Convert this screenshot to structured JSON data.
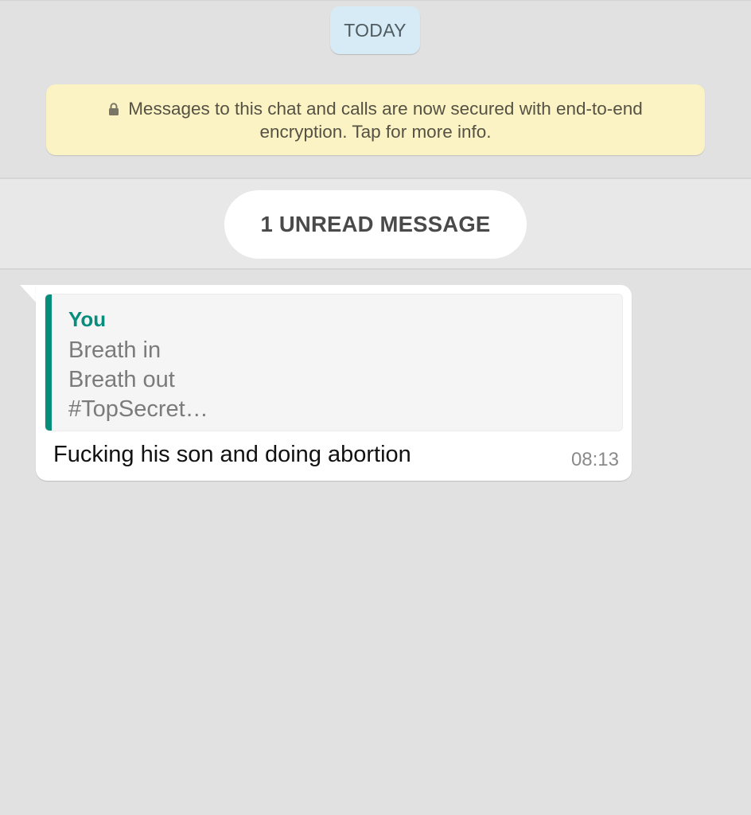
{
  "date_chip": {
    "label": "TODAY"
  },
  "encryption_notice": {
    "line1": "Messages to this chat and calls are now secured with end-to-end",
    "line2": "encryption. Tap for more info.",
    "icon": "lock-icon"
  },
  "unread_divider": {
    "label": "1 UNREAD MESSAGE"
  },
  "message": {
    "quoted": {
      "author": "You",
      "lines": [
        "Breath in",
        "Breath out",
        "#TopSecret…"
      ]
    },
    "text": "Fucking his son and doing abortion",
    "time": "08:13"
  },
  "colors": {
    "chat_background": "#e1e1e1",
    "date_chip_background": "#d6ebf5",
    "encryption_banner_background": "#fbf3c3",
    "quote_accent": "#078d7c",
    "bubble_background": "#ffffff"
  }
}
